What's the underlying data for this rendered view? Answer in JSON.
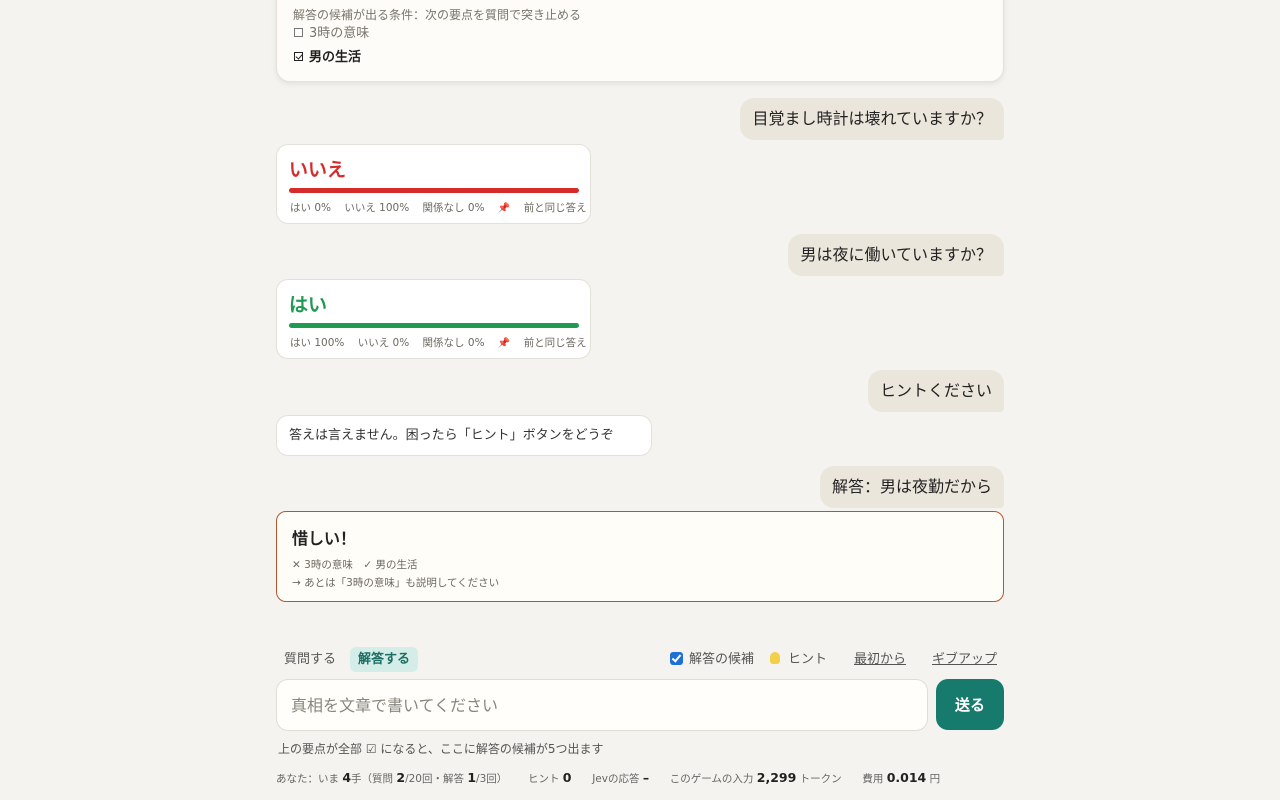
{
  "criteria": {
    "title": "解答の候補が出る条件：次の要点を質問で突き止める",
    "items": [
      {
        "label": "3時の意味",
        "checked": false
      },
      {
        "label": "男の生活",
        "checked": true
      }
    ]
  },
  "conversation": {
    "q1": "目覚まし時計は壊れていますか？",
    "a1": {
      "verdict": "いいえ",
      "stats": {
        "yes": "はい 0%",
        "no": "いいえ 100%",
        "irrelevant": "関係なし 0%",
        "same": "前と同じ答え"
      }
    },
    "q2": "男は夜に働いていますか？",
    "a2": {
      "verdict": "はい",
      "stats": {
        "yes": "はい 100%",
        "no": "いいえ 0%",
        "irrelevant": "関係なし 0%",
        "same": "前と同じ答え"
      }
    },
    "q3": "ヒントください",
    "a3": "答えは言えません。困ったら「ヒント」ボタンをどうぞ",
    "q4": "解答：男は夜勤だから",
    "a4": {
      "title": "惜しい！",
      "line1": "✕ 3時の意味　✓ 男の生活",
      "line2": "→ あとは「3時の意味」も説明してください"
    }
  },
  "controls": {
    "mode_question": "質問する",
    "mode_answer": "解答する",
    "candidates_label": "解答の候補",
    "candidates_checked": true,
    "hint_label": "ヒント",
    "restart_label": "最初から",
    "giveup_label": "ギブアップ",
    "input_placeholder": "真相を文章で書いてください",
    "send_label": "送る",
    "note": "上の要点が全部 ☑ になると、ここに解答の候補が5つ出ます"
  },
  "status": {
    "player_prefix": "あなた：いま",
    "moves": "4",
    "moves_unit": "手（質問",
    "questions": "2",
    "questions_unit": "/20回・解答",
    "answers": "1",
    "answers_unit": "/3回）",
    "hint_label": "ヒント",
    "hints": "0",
    "jev_label": "Jevの応答",
    "jev_value": "–",
    "input_label": "このゲームの入力",
    "tokens": "2,299",
    "tokens_unit": "トークン",
    "cost_label": "費用",
    "cost": "0.014",
    "cost_unit": "円"
  },
  "colors": {
    "accent": "#167a6c",
    "no": "#d62b2b",
    "yes": "#1f9a52",
    "verdict_border": "#b4572e"
  }
}
